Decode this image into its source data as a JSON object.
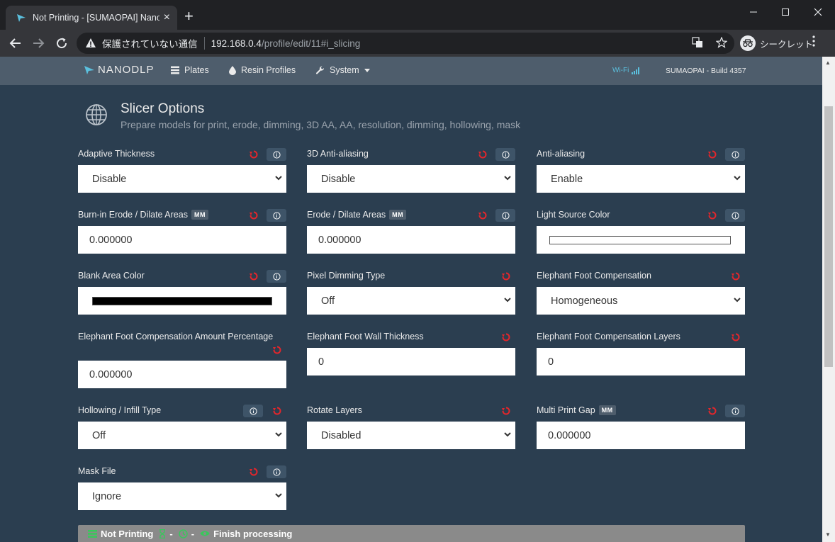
{
  "browser": {
    "tab_title": "Not Printing - [SUMAOPAI] Nano",
    "security_text": "保護されていない通信",
    "url_host": "192.168.0.4",
    "url_path": "/profile/edit/11#i_slicing",
    "incognito_label": "シークレット"
  },
  "nav": {
    "brand": "NANODLP",
    "plates": "Plates",
    "resin_profiles": "Resin Profiles",
    "system": "System",
    "wifi": "Wi-Fi",
    "build": "SUMAOPAI - Build 4357"
  },
  "section": {
    "title": "Slicer Options",
    "subtitle": "Prepare models for print, erode, dimming, 3D AA, AA, resolution, dimming, hollowing, mask"
  },
  "fields": {
    "adaptive_thickness": {
      "label": "Adaptive Thickness",
      "value": "Disable"
    },
    "aa3d": {
      "label": "3D Anti-aliasing",
      "value": "Disable"
    },
    "anti_aliasing": {
      "label": "Anti-aliasing",
      "value": "Enable"
    },
    "burnin_erode": {
      "label": "Burn-in Erode / Dilate Areas",
      "badge": "MM",
      "value": "0.000000"
    },
    "erode": {
      "label": "Erode / Dilate Areas",
      "badge": "MM",
      "value": "0.000000"
    },
    "light_source_color": {
      "label": "Light Source Color",
      "swatch": "#ffffff"
    },
    "blank_area_color": {
      "label": "Blank Area Color",
      "swatch": "#000000"
    },
    "pixel_dimming": {
      "label": "Pixel Dimming Type",
      "value": "Off"
    },
    "efc": {
      "label": "Elephant Foot Compensation",
      "value": "Homogeneous"
    },
    "efc_amount": {
      "label": "Elephant Foot Compensation Amount Percentage",
      "value": "0.000000"
    },
    "ef_wall": {
      "label": "Elephant Foot Wall Thickness",
      "value": "0"
    },
    "efc_layers": {
      "label": "Elephant Foot Compensation Layers",
      "value": "0"
    },
    "hollowing": {
      "label": "Hollowing / Infill Type",
      "value": "Off"
    },
    "rotate_layers": {
      "label": "Rotate Layers",
      "value": "Disabled"
    },
    "multi_print_gap": {
      "label": "Multi Print Gap",
      "badge": "MM",
      "value": "0.000000"
    },
    "mask_file": {
      "label": "Mask File",
      "value": "Ignore"
    }
  },
  "status": {
    "state": "Not Printing",
    "layers": "-",
    "time": "-",
    "processing": "Finish processing"
  },
  "colors": {
    "background": "#2b3e50",
    "navbar": "#4e5d6c",
    "reset_icon": "#e3262b",
    "status_green": "#37c95a"
  }
}
